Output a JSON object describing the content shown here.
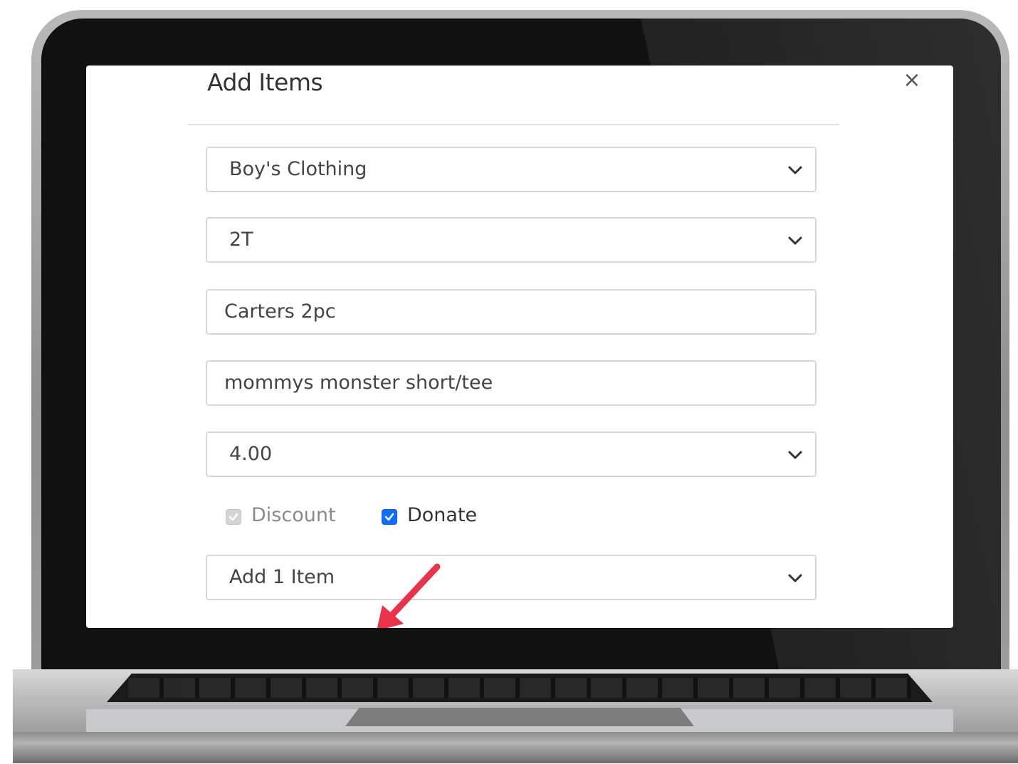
{
  "modal": {
    "title": "Add Items",
    "close_label": "×"
  },
  "form": {
    "category": {
      "selected": "Boy's Clothing"
    },
    "size": {
      "selected": "2T"
    },
    "brand": {
      "value": "Carters 2pc"
    },
    "description": {
      "value": "mommys monster short/tee"
    },
    "price": {
      "selected": "4.00"
    },
    "discount": {
      "label": "Discount",
      "checked": true,
      "disabled": true
    },
    "donate": {
      "label": "Donate",
      "checked": true,
      "disabled": false
    },
    "quantity": {
      "selected": "Add 1 Item"
    }
  },
  "icons": {
    "dropdown": "chevron-down-icon",
    "close": "close-icon",
    "check": "check-icon",
    "annotation": "red-arrow-icon"
  },
  "colors": {
    "accent_blue": "#0d6efd",
    "annotation_red": "#e8334a",
    "field_border": "#d5d9de"
  }
}
